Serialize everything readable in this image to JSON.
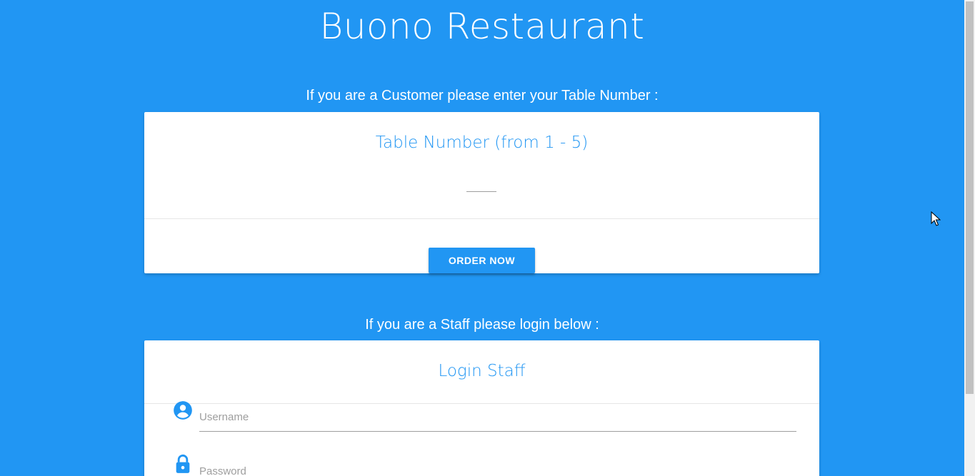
{
  "app": {
    "title": "Buono Restaurant"
  },
  "customer": {
    "heading": "If you are a Customer please enter your Table Number :",
    "card_title": "Table Number (from 1 - 5)",
    "table_input_value": "",
    "order_button_label": "ORDER NOW"
  },
  "staff": {
    "heading": "If you are a Staff please login below :",
    "card_title": "Login Staff",
    "username_placeholder": "Username",
    "password_placeholder": "Password"
  },
  "icons": {
    "username": "account-circle-icon",
    "password": "lock-icon"
  },
  "colors": {
    "background": "#2196f3",
    "accent": "#2196f3",
    "card": "#ffffff"
  }
}
